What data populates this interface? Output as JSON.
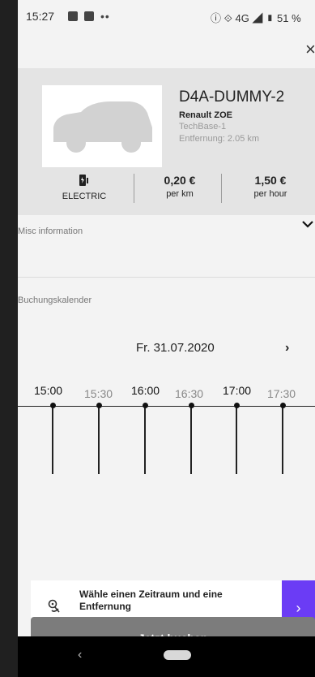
{
  "status_bar": {
    "time": "15:27",
    "right_text": "ⓘ ⟐ 4G ◢ ▮ 51 %"
  },
  "header": {
    "close_icon": "close-icon"
  },
  "vehicle": {
    "name": "D4A-DUMMY-2",
    "model": "Renault ZOE",
    "base": "TechBase-1",
    "distance": "Entfernung: 2.05 km",
    "fuel_label": "ELECTRIC",
    "price_km_value": "0,20 €",
    "price_km_label": "per km",
    "price_hour_value": "1,50 €",
    "price_hour_label": "per hour"
  },
  "sections": {
    "misc_label": "Misc information",
    "booking_label": "Buchungskalender"
  },
  "calendar": {
    "date": "Fr. 31.07.2020",
    "times": [
      "15:00",
      "15:30",
      "16:00",
      "16:30",
      "17:00",
      "17:30"
    ]
  },
  "hint": {
    "text": "Wähle einen Zeitraum und eine Entfernung",
    "accent_color": "#6b3cf5"
  },
  "actions": {
    "book_label": "Jetzt buchen"
  }
}
